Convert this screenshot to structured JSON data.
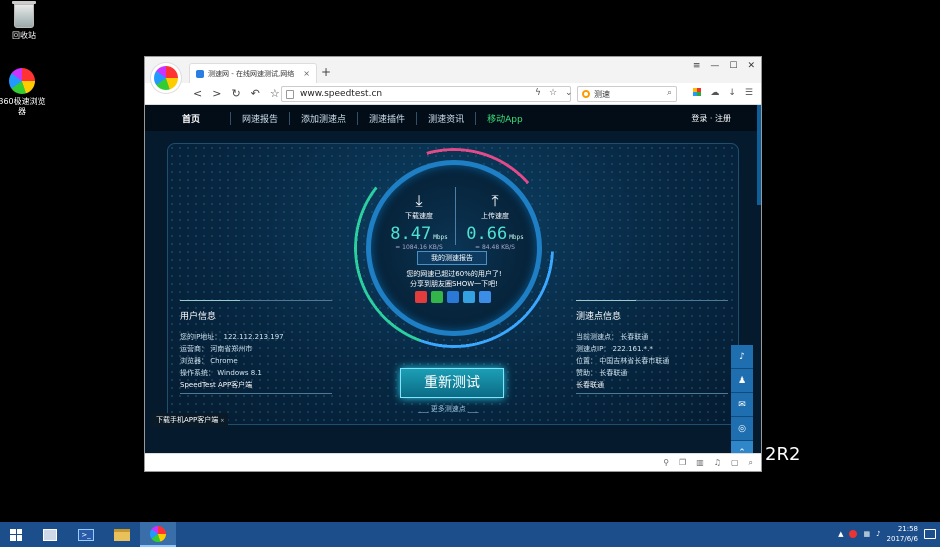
{
  "desktop": {
    "icons": [
      {
        "name": "回收站"
      },
      {
        "name": "360极速浏览器"
      }
    ],
    "trailing_text": "2R2"
  },
  "browser": {
    "tab_title": "测速网 - 在线网速测试,网络",
    "tab_close": "×",
    "new_tab": "+",
    "url": "www.speedtest.cn",
    "search_value": "测速",
    "window_controls": [
      "≡",
      "—",
      "☐",
      "✕"
    ],
    "nav_icons": [
      "<",
      ">",
      "↻",
      "↶",
      "☆"
    ]
  },
  "page": {
    "nav": [
      "首页",
      "网速报告",
      "添加测速点",
      "测速插件",
      "测速资讯",
      "移动App"
    ],
    "login": "登录 · 注册",
    "download": {
      "label": "下载速度",
      "value": "8.47",
      "unit": "Mbps",
      "sub": "= 1084.16 KB/S"
    },
    "upload": {
      "label": "上传速度",
      "value": "0.66",
      "unit": "Mbps",
      "sub": "= 84.48 KB/S"
    },
    "report_button": "我的测速报告",
    "share_line1": "您的网速已超过60%的用户了!",
    "share_line2": "分享到朋友圈SHOW一下吧!",
    "retest_button": "重新测试",
    "more_points": "___ 更多测速点 ___",
    "user_info": {
      "title": "用户信息",
      "lines": [
        "您的IP地址： 122.112.213.197",
        "运营商： 河南省郑州市",
        "浏览器： Chrome",
        "操作系统： Windows 8.1"
      ],
      "footer": "SpeedTest APP客户端"
    },
    "server_info": {
      "title": "测速点信息",
      "lines": [
        "当前测速点： 长春联通",
        "测速点IP： 222.161.*.*",
        "位置： 中国吉林省长春市联通",
        "赞助： 长春联通"
      ],
      "footer": "长春联通"
    },
    "download_app": "下载手机APP客户端",
    "download_app_close": "×"
  },
  "taskbar": {
    "time": "21:58",
    "date": "2017/6/6",
    "tray_arrow": "▲"
  }
}
